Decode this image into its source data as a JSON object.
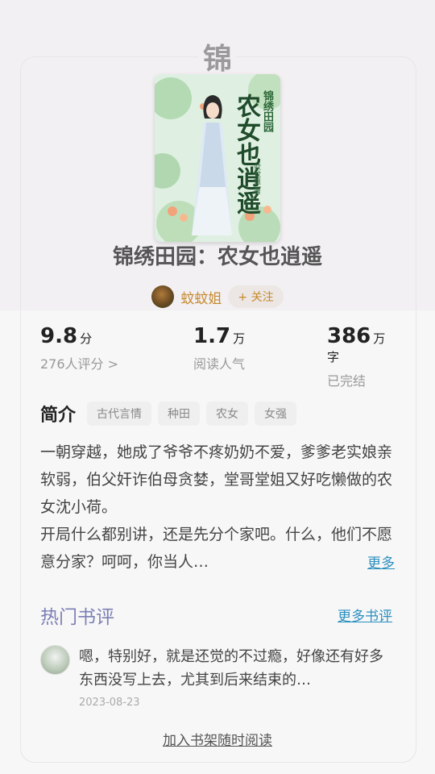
{
  "logo_text": "锦",
  "book": {
    "title": "锦绣田园：农女也逍遥",
    "cover_small_title": "锦绣田园",
    "cover_big_title": "农女也逍遥",
    "cover_author_mark": "蚊蚊姐 著"
  },
  "author": {
    "name": "蚊蚊姐",
    "follow_label": "+ 关注"
  },
  "stats": [
    {
      "value": "9.8",
      "unit": "分",
      "label": "276人评分 >"
    },
    {
      "value": "1.7",
      "unit": "万",
      "label": "阅读人气"
    },
    {
      "value": "386",
      "unit": "万字",
      "label": "已完结"
    }
  ],
  "intro": {
    "title": "简介",
    "tags": [
      "古代言情",
      "种田",
      "农女",
      "女强"
    ],
    "para1": "一朝穿越，她成了爷爷不疼奶奶不爱，爹爹老实娘亲软弱，伯父奸诈伯母贪婪，堂哥堂姐又好吃懒做的农女沈小荷。",
    "para2": "开局什么都别讲，还是先分个家吧。什么，他们不愿意分家？呵呵，你当人…",
    "more_label": "更多"
  },
  "reviews": {
    "title": "热门书评",
    "more_label": "更多书评",
    "items": [
      {
        "text": "嗯，特别好，就是还觉的不过瘾，好像还有好多东西没写上去，尤其到后来结束的…",
        "date": "2023-08-23"
      }
    ]
  },
  "footer": {
    "add_to_shelf": "加入书架随时阅读"
  },
  "colors": {
    "accent_link": "#2b8fbf",
    "author_gold": "#c58a2e",
    "review_title": "#7b7fb4"
  }
}
